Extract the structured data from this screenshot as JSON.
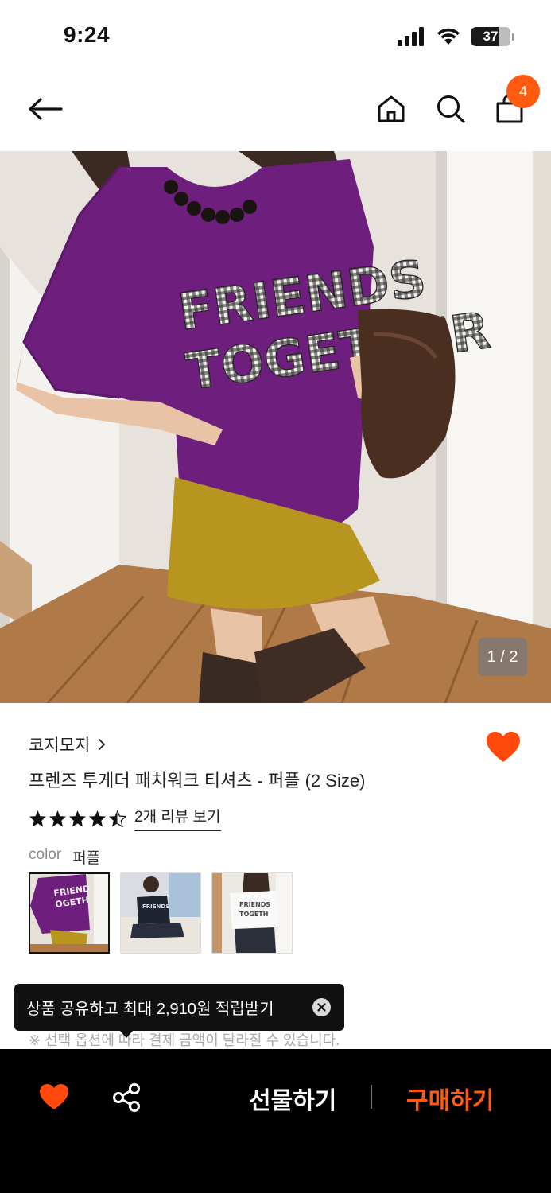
{
  "status_bar": {
    "time": "9:24",
    "battery": "37"
  },
  "header": {
    "cart_count": "4"
  },
  "gallery": {
    "indicator": "1 / 2"
  },
  "product": {
    "brand": "코지모지",
    "title": "프렌즈 투게더 패치워크 티셔츠 - 퍼플 (2 Size)",
    "rating": 4.5,
    "review_link": "2개 리뷰 보기",
    "color_label": "color",
    "color_value": "퍼플",
    "shirt_text_line1": "FRIENDS",
    "shirt_text_line2": "TOGETHER"
  },
  "tooltip": {
    "text": "상품 공유하고 최대 2,910원 적립받기"
  },
  "notice": "※ 선택 옵션에 따라 결제 금액이 달라질 수 있습니다.",
  "bottom_bar": {
    "gift_label": "선물하기",
    "buy_label": "구매하기"
  },
  "colors": {
    "accent": "#ff5a0f",
    "shirt_purple": "#6e1f7e",
    "skirt_mustard": "#b8951f"
  }
}
